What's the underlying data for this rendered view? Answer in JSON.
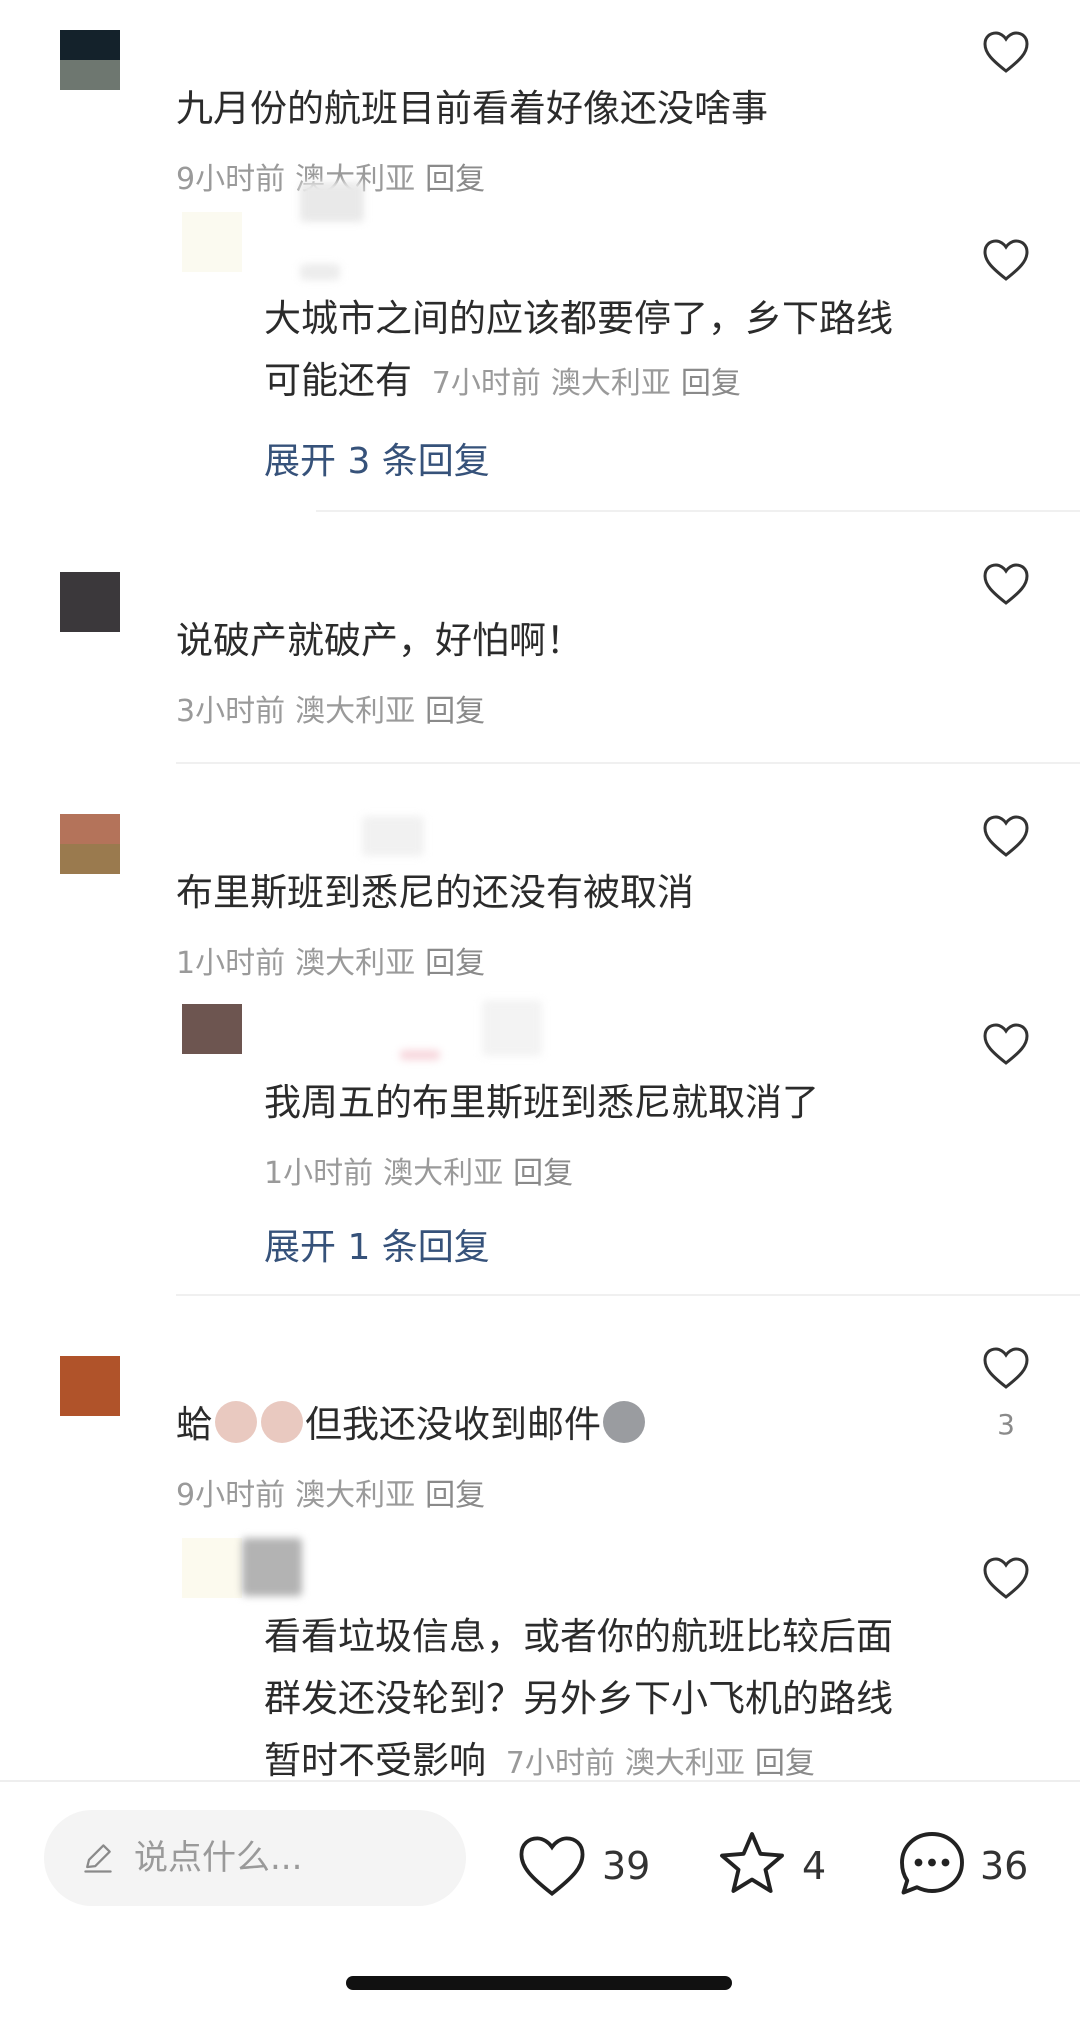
{
  "comments": [
    {
      "text": "九月份的航班目前看着好像还没啥事",
      "time": "9小时前",
      "location": "澳大利亚",
      "reply": "回复",
      "replies": [
        {
          "text_line1": "大城市之间的应该都要停了，乡下路线",
          "text_line2": "可能还有",
          "time": "7小时前",
          "location": "澳大利亚",
          "reply": "回复"
        }
      ],
      "expand": "展开 3 条回复"
    },
    {
      "text": "说破产就破产，好怕啊！",
      "time": "3小时前",
      "location": "澳大利亚",
      "reply": "回复"
    },
    {
      "text": "布里斯班到悉尼的还没有被取消",
      "time": "1小时前",
      "location": "澳大利亚",
      "reply": "回复",
      "replies": [
        {
          "text": "我周五的布里斯班到悉尼就取消了",
          "time": "1小时前",
          "location": "澳大利亚",
          "reply": "回复"
        }
      ],
      "expand": "展开 1 条回复"
    },
    {
      "text_before": "蛤",
      "text_after": "但我还没收到邮件",
      "like_count": "3",
      "time": "9小时前",
      "location": "澳大利亚",
      "reply": "回复",
      "replies": [
        {
          "text_line1": "看看垃圾信息，或者你的航班比较后面",
          "text_line2": "群发还没轮到？另外乡下小飞机的路线",
          "text_line3": "暂时不受影响",
          "time": "7小时前",
          "location": "澳大利亚",
          "reply": "回复"
        }
      ]
    }
  ],
  "bottom_bar": {
    "placeholder": "说点什么...",
    "like_count": "39",
    "favorite_count": "4",
    "comment_count": "36"
  },
  "icons": [
    "heart-outline-icon",
    "star-outline-icon",
    "chat-bubble-icon",
    "pencil-icon"
  ],
  "colors": {
    "link": "#36527a",
    "meta": "#9a9a9a",
    "text": "#2b2b2b"
  }
}
